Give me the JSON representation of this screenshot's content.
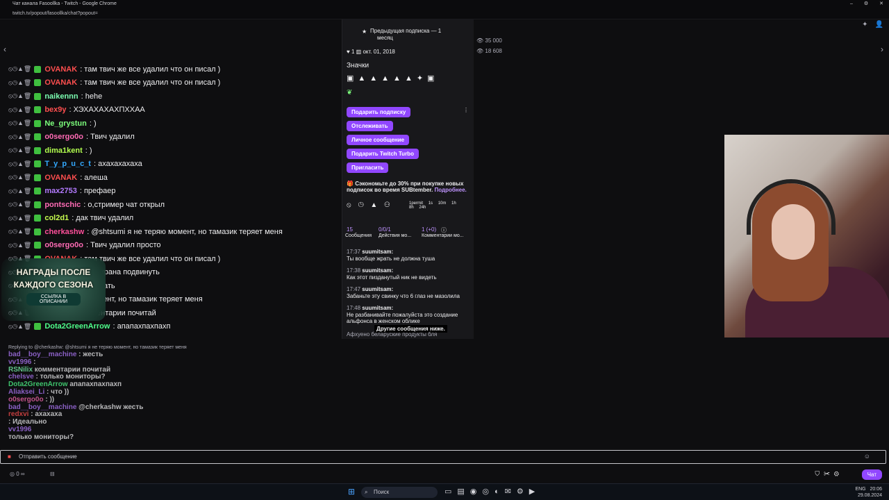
{
  "window": {
    "title": "Чат канала Fasoollka - Twitch - Google Chrome",
    "url": "twitch.tv/popout/fasoollka/chat?popout="
  },
  "chat": [
    {
      "user": "OVANAK",
      "color": "#ff4f4f",
      "text": ": там твич же все удалил что он писал )"
    },
    {
      "user": "OVANAK",
      "color": "#ff4f4f",
      "text": ": там твич же все удалил что он писал )"
    },
    {
      "user": "naikennn",
      "color": "#7cffb2",
      "text": ": hehe"
    },
    {
      "user": "bex9y",
      "color": "#ff4f4f",
      "text": ": ХЭХАХАХАХПХХАА"
    },
    {
      "user": "Ne_grystun",
      "color": "#7cff7c",
      "text": ": )"
    },
    {
      "user": "o0sergo0o",
      "color": "#ff6bb5",
      "text": ": Твич удалил"
    },
    {
      "user": "dima1kent",
      "color": "#b3ff4f",
      "text": ": )"
    },
    {
      "user": "T_y_p_u_c_t",
      "color": "#33a9ff",
      "text": ": ахахахахаха"
    },
    {
      "user": "OVANAK",
      "color": "#ff4f4f",
      "text": ": алеша"
    },
    {
      "user": "max2753",
      "color": "#b37bff",
      "text": ": префаер"
    },
    {
      "user": "pontschic",
      "color": "#ff6bb5",
      "text": ": о,стример чат открыл"
    },
    {
      "user": "col2d1",
      "color": "#c8ff4f",
      "text": ": дак твич удалил"
    },
    {
      "user": "cherkashw",
      "color": "#ff4f9b",
      "text": ": @shtsumi я не теряю момент, но тамазик теряет меня"
    },
    {
      "user": "o0sergo0o",
      "color": "#ff6bb5",
      "text": ": Твич удалил просто"
    },
    {
      "user": "OVANAK",
      "color": "#ff4f4f",
      "text": ": там твич же все удалил что он писал )"
    },
    {
      "user": "",
      "color": "#efeff1",
      "text": "может к краю экрана подвинуть"
    },
    {
      "user": "",
      "color": "#efeff1",
      "text": ": пора разбанивать"
    },
    {
      "user": "",
      "color": "#efeff1",
      "text": "я не теряю момент, но тамазик теряет меня"
    },
    {
      "user": "RSNilix",
      "color": "#7cffb2",
      "text": ": комментарии почитай"
    },
    {
      "user": "Dota2GreenArrow",
      "color": "#4fff8b",
      "text": ": апапахпахпахп"
    }
  ],
  "promo": {
    "title_line1": "НАГРАДЫ ПОСЛЕ",
    "title_line2": "КАЖДОГО СЕЗОНА",
    "link": "ССЫЛКА В ОПИСАНИИ"
  },
  "reply_note": "Replying to @cherkashw: @shtsumi я не теряю момент, но тамазик теряет меня",
  "overlay_lines": [
    {
      "user": "bad__boy__machine",
      "color": "#b37bff",
      "text": ": жесть"
    },
    {
      "user": "vv1996",
      "color": "#b37bff",
      "text": ":"
    },
    {
      "user": "RSNilix",
      "color": "#7cffb2",
      "text": "комментарии почитай"
    },
    {
      "user": "chelsve",
      "color": "#b37bff",
      "text": ": только мониторы?"
    },
    {
      "user": "Dota2GreenArrow",
      "color": "#4fff8b",
      "text": "апапахпахпахп"
    },
    {
      "user": "Aliaksei_Li",
      "color": "#b37bff",
      "text": ": что ))"
    },
    {
      "user": "o0sergo0o",
      "color": "#ff6bb5",
      "text": ": ))"
    },
    {
      "user": "bad__boy__machine",
      "color": "#b37bff",
      "text": "@cherkashw жесть"
    },
    {
      "user": "redxvi",
      "color": "#ff4f4f",
      "text": ": ахахаха"
    },
    {
      "user": "",
      "color": "#efeff1",
      "text": ": Идеально"
    },
    {
      "user": "vv1996",
      "color": "#b37bff",
      "text": ""
    },
    {
      "user": "",
      "color": "#efeff1",
      "text": "только мониторы?"
    }
  ],
  "card": {
    "prev_sub_line1": "Предыдущая подписка — 1",
    "prev_sub_line2": "месяц",
    "months": "1",
    "date": "окт. 01, 2018",
    "badges_title": "Значки",
    "btn_gift": "Подарить подписку",
    "btn_follow": "Отслеживать",
    "btn_whisper": "Личное сообщение",
    "btn_turbo": "Подарить Twitch Turbo",
    "btn_invite": "Пригласить",
    "promo_text": "Сэкономьте до 30% при покупке новых подписок во время SUBtember.",
    "promo_link": "Подробнее.",
    "timeouts": [
      "1permit",
      "1s",
      "10m",
      "1h",
      "8h",
      "24h"
    ],
    "tab_messages_count": "15",
    "tab_messages_label": "Сообщения",
    "tab_actions_count": "0/0/1",
    "tab_actions_label": "Действия мо...",
    "tab_comments_count": "1 (+0)",
    "tab_comments_label": "Комментарии мо...",
    "history": [
      {
        "time": "17:37",
        "user": "suumitsam:",
        "text": "Ты вообще жрать не должна туша"
      },
      {
        "time": "17:38",
        "user": "suumitsam:",
        "text": "Как этот пизданутый ник не видеть"
      },
      {
        "time": "17:47",
        "user": "suumitsam:",
        "text": "Забаньте эту свинку что 6 глаз не мазолила"
      },
      {
        "time": "17:48",
        "user": "suumitsam:",
        "text": "Не разбанивайте пожалуйста это создание альфонса в женском облике"
      }
    ],
    "more_below": "Другие сообщения ниже.",
    "last_line": "Афхуено беларуские продукты бля"
  },
  "stats": {
    "viewers1": "35 000",
    "viewers2": "18 608"
  },
  "send": {
    "placeholder": "Отправить сообщение",
    "chat_button": "Чат"
  },
  "taskbar": {
    "search": "Поиск",
    "lang": "ENG",
    "time": "20:06",
    "date": "29.08.2024"
  }
}
